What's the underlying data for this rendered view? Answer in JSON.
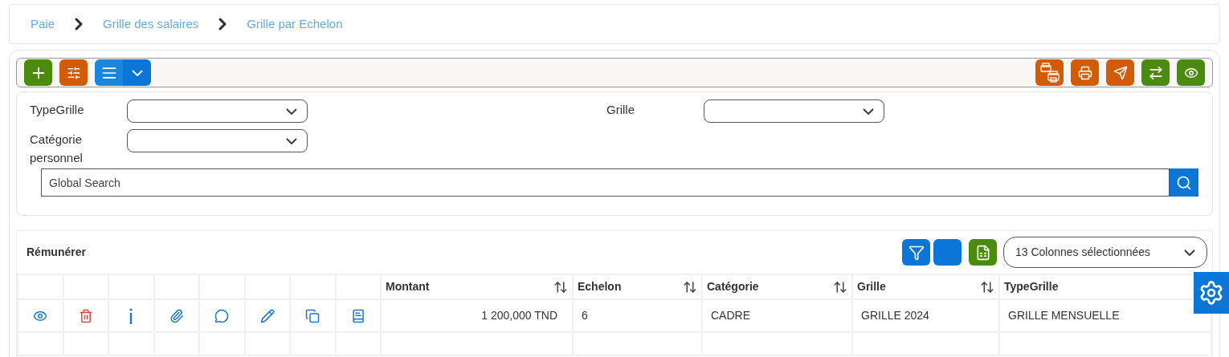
{
  "breadcrumb": [
    {
      "label": "Paie"
    },
    {
      "label": "Grille des salaires"
    },
    {
      "label": "Grille par Echelon"
    }
  ],
  "filter_rows": [
    {
      "fields": [
        {
          "label_lines": [
            "TypeGrille"
          ]
        },
        {
          "label_lines": [
            "Grille"
          ]
        }
      ]
    },
    {
      "fields": [
        {
          "label_lines": [
            "Catégorie",
            "personnel"
          ]
        }
      ]
    }
  ],
  "search": {
    "placeholder": "Global Search"
  },
  "table": {
    "title": "Rémunérer",
    "column_selector": "13 Colonnes sélectionnées",
    "columns": [
      {
        "label": "Montant",
        "sortable": true
      },
      {
        "label": "Echelon",
        "sortable": true
      },
      {
        "label": "Catégorie",
        "sortable": true
      },
      {
        "label": "Grille",
        "sortable": true
      },
      {
        "label": "TypeGrille",
        "sortable": false
      }
    ],
    "rows": [
      {
        "cells": [
          "1 200,000 TND",
          "6",
          "CADRE",
          "GRILLE 2024",
          "GRILLE MENSUELLE"
        ]
      }
    ]
  }
}
